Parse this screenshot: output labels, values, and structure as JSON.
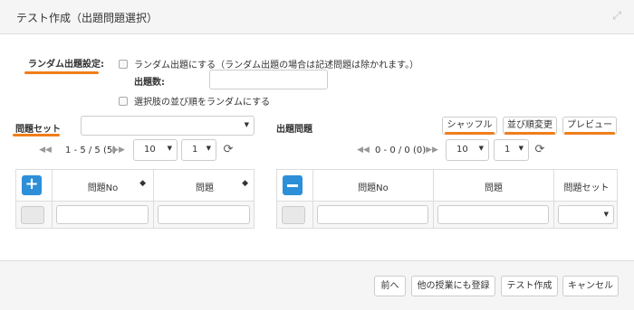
{
  "window": {
    "title": "テスト作成（出題問題選択）"
  },
  "random": {
    "label": "ランダム出題設定:",
    "random_checkbox_label": "ランダム出題にする（ランダム出題の場合は記述問題は除かれます。）",
    "count_label": "出題数:",
    "count_value": "",
    "shuffle_choices_label": "選択肢の並び順をランダムにする"
  },
  "left": {
    "set_label": "問題セット",
    "set_value": "",
    "pager_info": "1 - 5 / 5 (5)",
    "page_size": "10",
    "page": "1",
    "columns": [
      "問題No",
      "問題"
    ]
  },
  "right": {
    "label": "出題問題",
    "shuffle_button": "シャッフル",
    "reorder_button": "並び順変更",
    "preview_button": "プレビュー",
    "pager_info": "0 - 0 / 0 (0)",
    "page_size": "10",
    "page": "1",
    "columns": [
      "問題No",
      "問題",
      "問題セット"
    ]
  },
  "footer": {
    "prev_button": "前へ",
    "register_button": "他の授業にも登録",
    "create_button": "テスト作成",
    "cancel_button": "キャンセル"
  },
  "colors": {
    "accent_underline": "#f07d1a",
    "primary_blue": "#2d8fd8"
  }
}
